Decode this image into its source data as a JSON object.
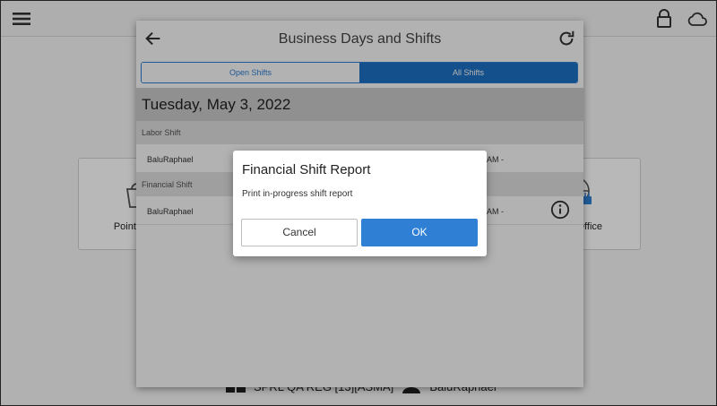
{
  "app": {
    "bottom_info": {
      "register": "SPRL QA REG [13][ASMA]",
      "user": "BaluRaphael"
    },
    "tiles": [
      {
        "label": "Point of Sale"
      },
      {
        "label": "Back Office"
      }
    ]
  },
  "panel": {
    "title": "Business Days and Shifts",
    "tabs": [
      {
        "label": "Open Shifts",
        "active": false
      },
      {
        "label": "All Shifts",
        "active": true
      }
    ],
    "date": "Tuesday, May 3, 2022",
    "sections": [
      {
        "title": "Labor Shift",
        "rows": [
          {
            "name": "BaluRaphael",
            "time": "AM -"
          }
        ]
      },
      {
        "title": "Financial Shift",
        "rows": [
          {
            "name": "BaluRaphael",
            "time": "AM -"
          }
        ]
      }
    ]
  },
  "dialog": {
    "title": "Financial Shift Report",
    "message": "Print in-progress shift report",
    "cancel_label": "Cancel",
    "ok_label": "OK"
  },
  "colors": {
    "accent": "#2f80d5",
    "tab_active": "#1e73c9",
    "date_bar": "#cfcfcf"
  }
}
